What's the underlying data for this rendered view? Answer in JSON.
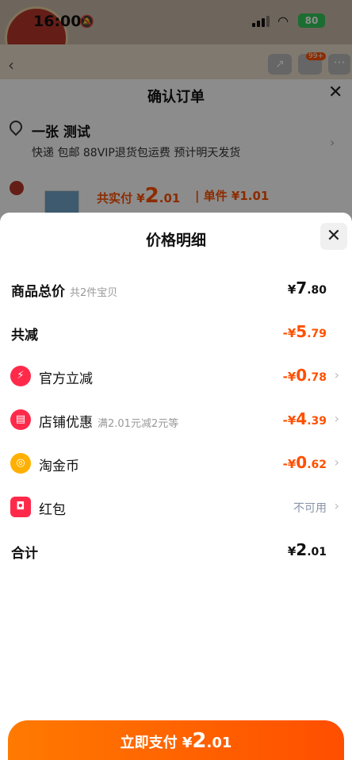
{
  "status": {
    "time": "16:00",
    "battery": "80"
  },
  "order": {
    "title": "确认订单",
    "address_name": "一张 测试",
    "address_sub": "快递 包邮 88VIP退货包运费 预计明天发货",
    "price_label": "共实付 ¥",
    "price_int": "2",
    "price_dec": ".01",
    "unit_label": "| 单件 ¥1.01",
    "cart_badge": "99+"
  },
  "sheet": {
    "title": "价格明细",
    "rows": [
      {
        "label": "商品总价",
        "note": "共2件宝贝",
        "value_prefix": "¥",
        "value_int": "7",
        "value_dec": ".80"
      },
      {
        "label": "共减",
        "value_prefix": "-¥",
        "value_int": "5",
        "value_dec": ".79"
      },
      {
        "label": "官方立减",
        "icon": "lightning-icon",
        "value_prefix": "-¥",
        "value_int": "0",
        "value_dec": ".78"
      },
      {
        "label": "店铺优惠",
        "icon": "shop-icon",
        "note": "满2.01元减2元等",
        "value_prefix": "-¥",
        "value_int": "4",
        "value_dec": ".39"
      },
      {
        "label": "淘金币",
        "icon": "coin-icon",
        "value_prefix": "-¥",
        "value_int": "0",
        "value_dec": ".62"
      },
      {
        "label": "红包",
        "icon": "red-packet-icon",
        "value_text": "不可用"
      },
      {
        "label": "合计",
        "value_prefix": "¥",
        "value_int": "2",
        "value_dec": ".01"
      }
    ]
  },
  "pay_button": {
    "label": "立即支付 ¥",
    "int": "2",
    "dec": ".01"
  },
  "colors": {
    "accent": "#ff5000",
    "button_start": "#ff7a00",
    "button_end": "#ff4e00",
    "official_icon": "#ff2a4a",
    "shop_icon": "#ff2a4a",
    "coin_icon": "#ffb000",
    "packet_icon": "#ff2a4a"
  }
}
